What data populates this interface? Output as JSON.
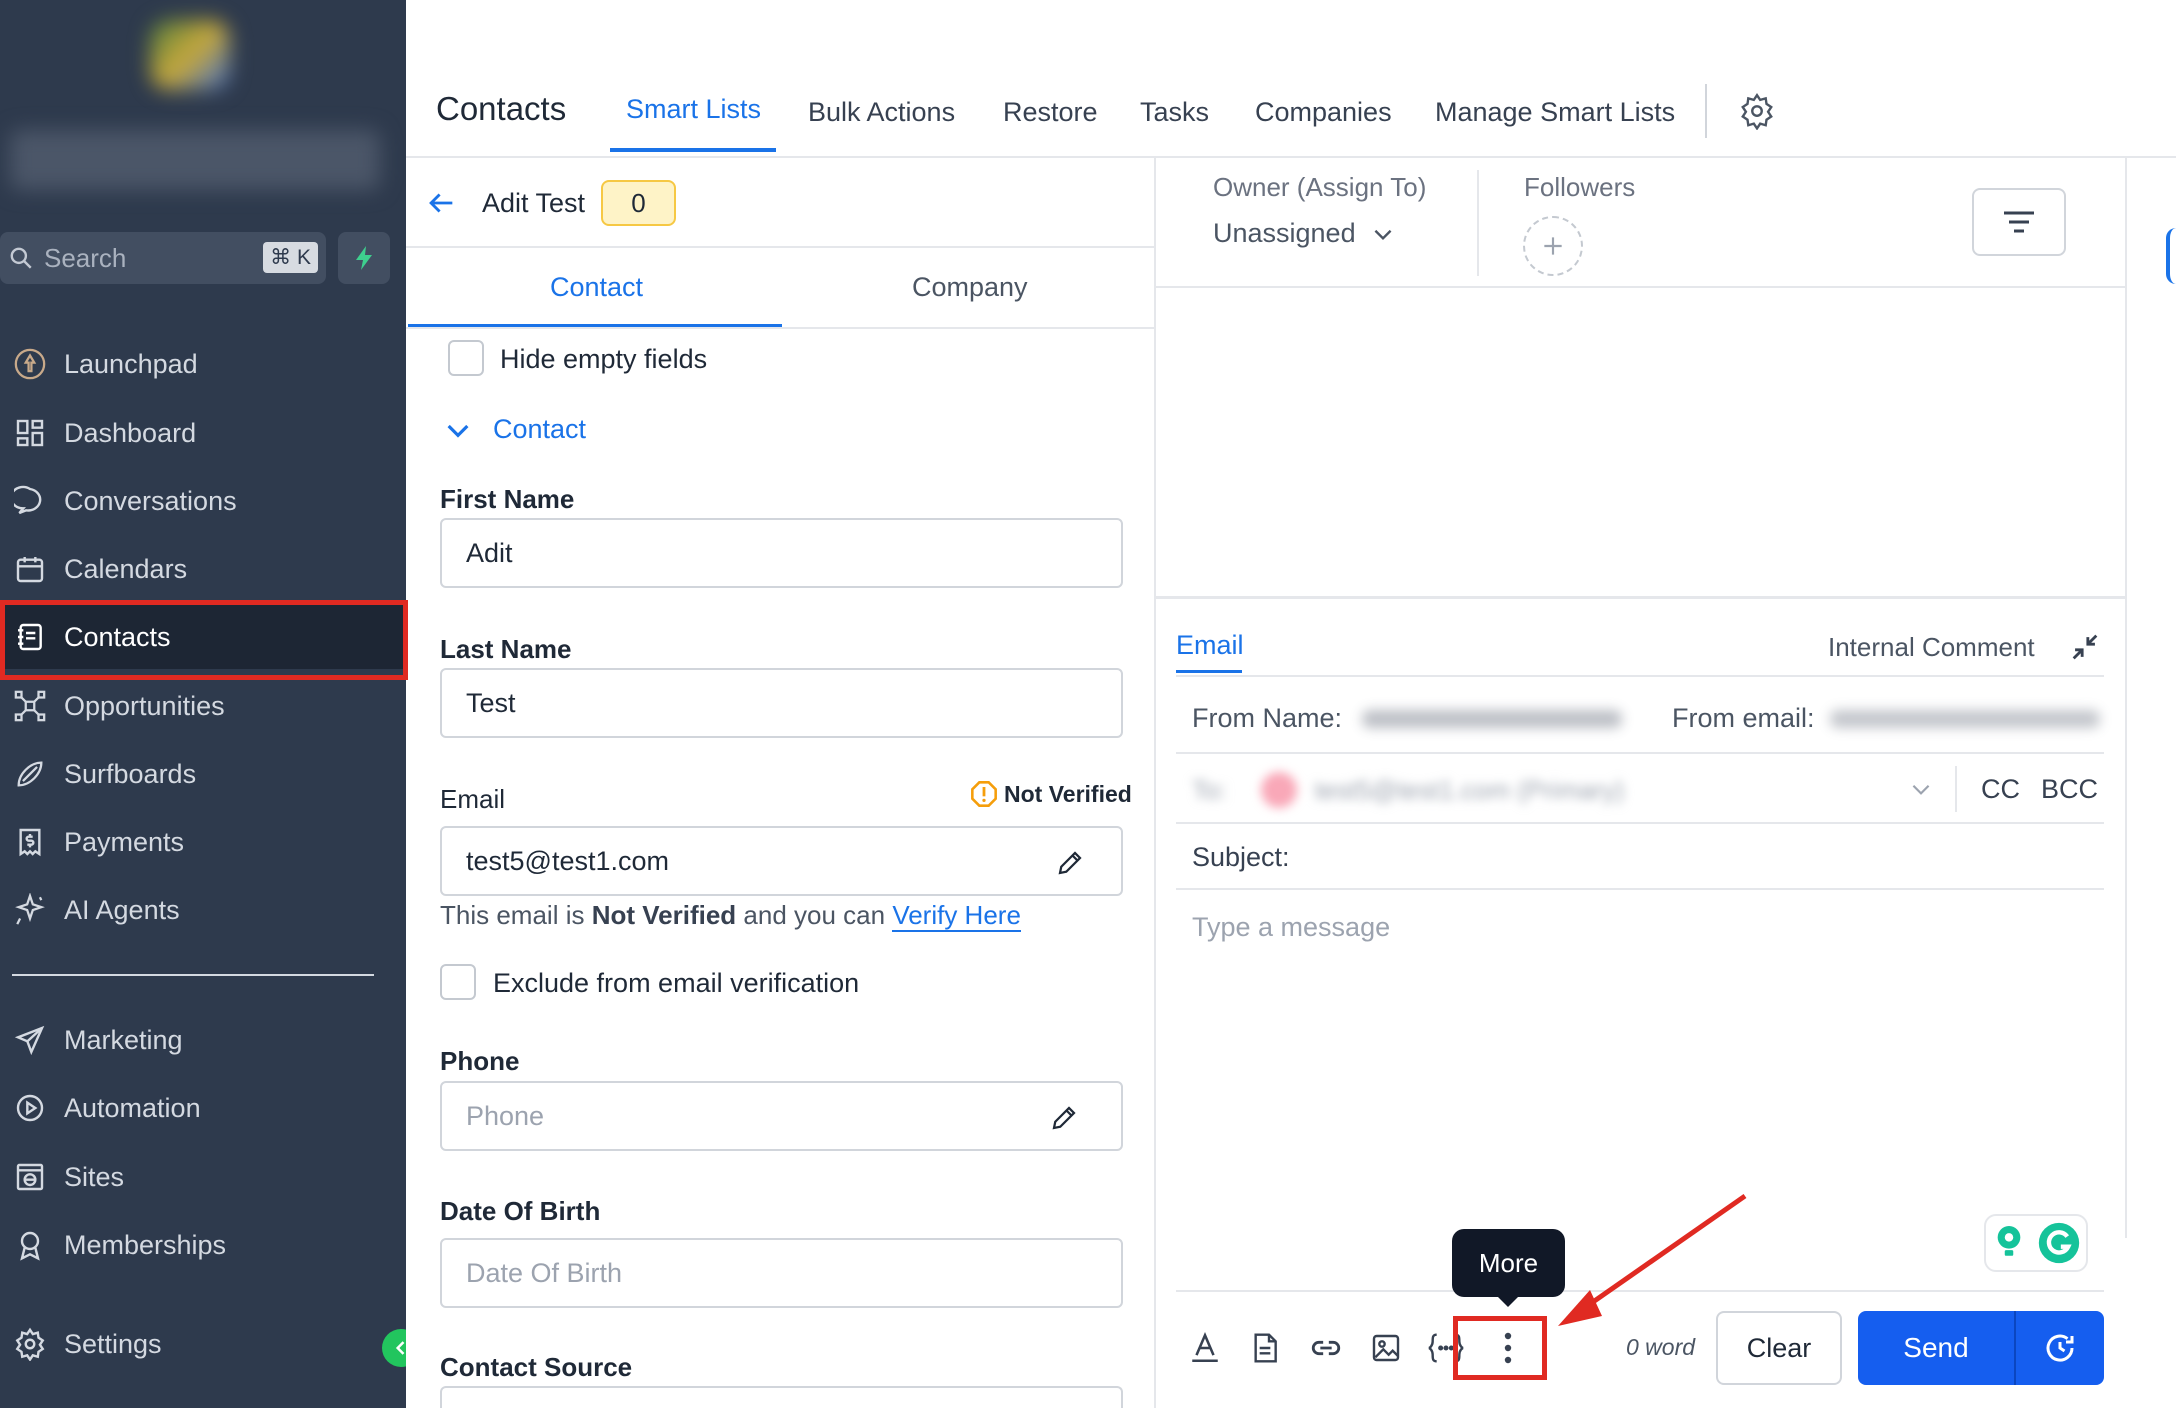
{
  "sidebar": {
    "search_placeholder": "Search",
    "search_shortcut": "⌘ K",
    "items": [
      {
        "label": "Launchpad",
        "icon": "rocket-icon"
      },
      {
        "label": "Dashboard",
        "icon": "dashboard-icon"
      },
      {
        "label": "Conversations",
        "icon": "chat-bubble-icon"
      },
      {
        "label": "Calendars",
        "icon": "calendar-icon"
      },
      {
        "label": "Contacts",
        "icon": "contacts-icon"
      },
      {
        "label": "Opportunities",
        "icon": "opportunities-icon"
      },
      {
        "label": "Surfboards",
        "icon": "surfboard-icon"
      },
      {
        "label": "Payments",
        "icon": "payments-icon"
      },
      {
        "label": "AI Agents",
        "icon": "sparkle-icon"
      },
      {
        "label": "Marketing",
        "icon": "send-icon"
      },
      {
        "label": "Automation",
        "icon": "automation-icon"
      },
      {
        "label": "Sites",
        "icon": "globe-icon"
      },
      {
        "label": "Memberships",
        "icon": "badge-icon"
      },
      {
        "label": "Settings",
        "icon": "gear-icon"
      }
    ]
  },
  "header": {
    "title": "Contacts",
    "tabs": [
      "Smart Lists",
      "Bulk Actions",
      "Restore",
      "Tasks",
      "Companies",
      "Manage Smart Lists"
    ],
    "active_tab": "Smart Lists"
  },
  "contact": {
    "name": "Adit Test",
    "count": "0",
    "tabs": [
      "Contact",
      "Company"
    ],
    "hide_empty_label": "Hide empty fields",
    "section_title": "Contact",
    "first_name_label": "First Name",
    "first_name_value": "Adit",
    "last_name_label": "Last Name",
    "last_name_value": "Test",
    "email_label": "Email",
    "email_status": "Not Verified",
    "email_value": "test5@test1.com",
    "verify_prefix": "This email is ",
    "verify_bold": "Not Verified",
    "verify_mid": " and you can ",
    "verify_link": "Verify Here",
    "exclude_label": "Exclude from email verification",
    "phone_label": "Phone",
    "phone_placeholder": "Phone",
    "dob_label": "Date Of Birth",
    "dob_placeholder": "Date Of Birth",
    "source_label": "Contact Source"
  },
  "owner": {
    "label": "Owner (Assign To)",
    "value": "Unassigned",
    "followers_label": "Followers"
  },
  "composer": {
    "tab_email": "Email",
    "tab_internal": "Internal Comment",
    "from_name_label": "From Name:",
    "from_email_label": "From email:",
    "to_label": "To:",
    "to_value": "test5@test1.com (Primary)",
    "cc": "CC",
    "bcc": "BCC",
    "subject_label": "Subject:",
    "message_placeholder": "Type a message",
    "word_count": "0 word",
    "clear": "Clear",
    "send": "Send",
    "tooltip": "More"
  },
  "colors": {
    "sidebar_bg": "#2e3a4d",
    "accent": "#1a73e8",
    "send_button": "#155eef",
    "highlight": "#e02a22",
    "badge_bg": "#fef3c7"
  }
}
